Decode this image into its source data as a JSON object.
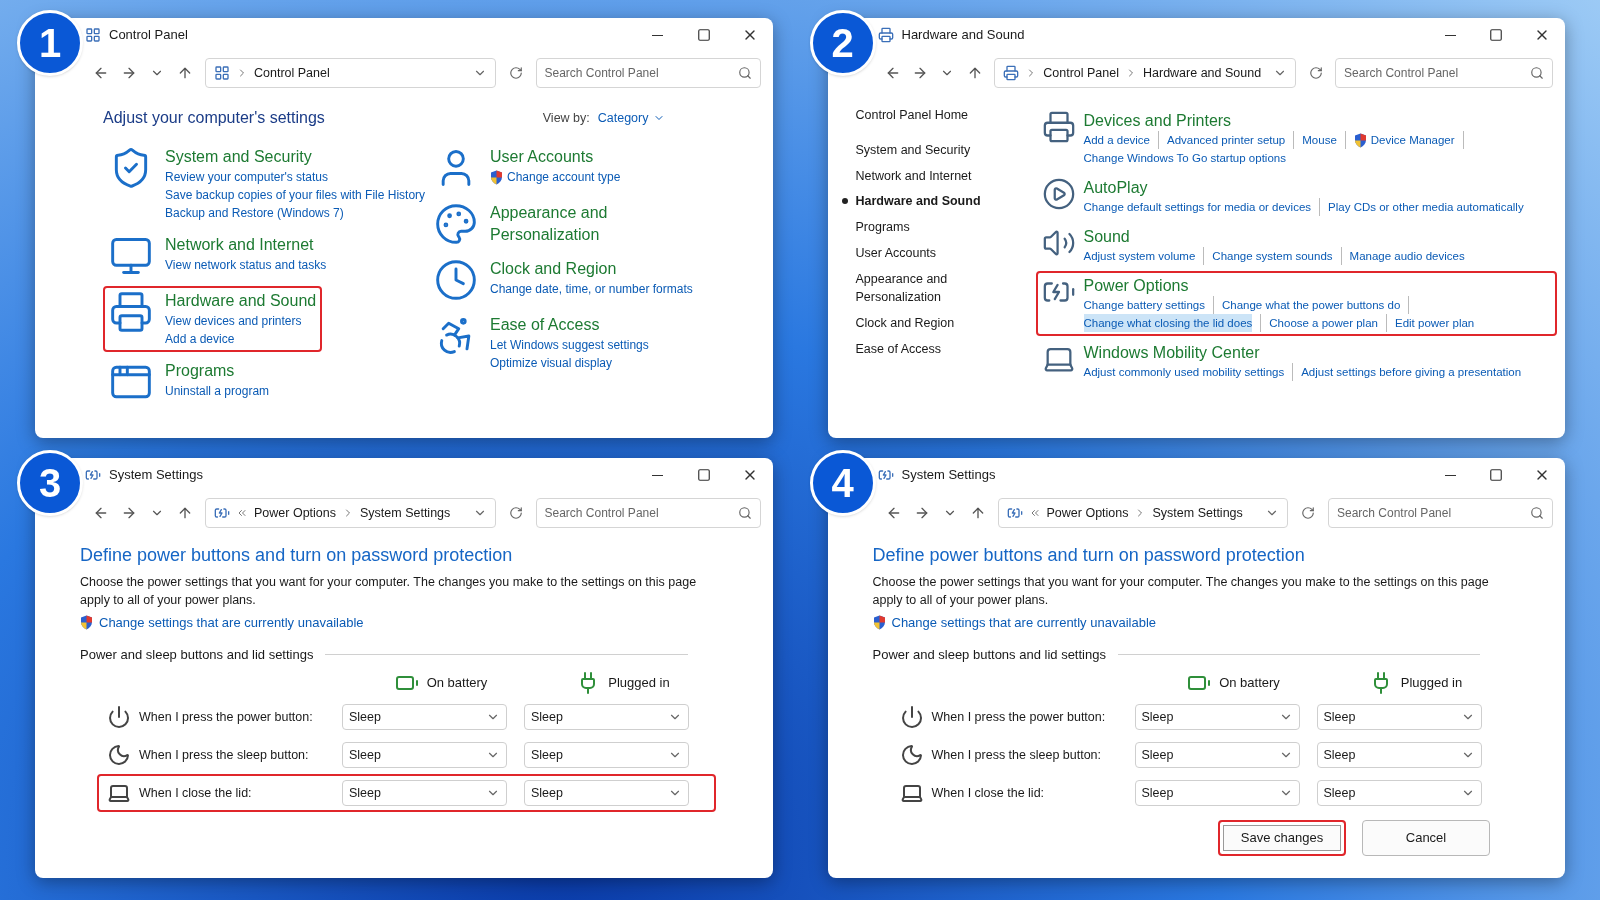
{
  "panels": [
    {
      "kind": "category",
      "step": "1",
      "title": "Control Panel",
      "truncated": false,
      "breadcrumb": [
        "Control Panel"
      ],
      "search_placeholder": "Search Control Panel",
      "heading": "Adjust your computer's settings",
      "view_by_label": "View by:",
      "view_by_value": "Category",
      "category_columns": [
        [
          {
            "title": "System and Security",
            "highlighted": false,
            "links": [
              {
                "text": "Review your computer's status",
                "shield": false
              },
              {
                "text": "Save backup copies of your files with File History",
                "shield": false
              },
              {
                "text": "Backup and Restore (Windows 7)",
                "shield": false
              }
            ]
          },
          {
            "title": "Network and Internet",
            "highlighted": false,
            "links": [
              {
                "text": "View network status and tasks",
                "shield": false
              }
            ]
          },
          {
            "title": "Hardware and Sound",
            "highlighted": true,
            "links": [
              {
                "text": "View devices and printers",
                "shield": false
              },
              {
                "text": "Add a device",
                "shield": false
              }
            ]
          },
          {
            "title": "Programs",
            "highlighted": false,
            "links": [
              {
                "text": "Uninstall a program",
                "shield": false
              }
            ]
          }
        ],
        [
          {
            "title": "User Accounts",
            "highlighted": false,
            "links": [
              {
                "text": "Change account type",
                "shield": true
              }
            ]
          },
          {
            "title": "Appearance and Personalization",
            "highlighted": false
          },
          {
            "title": "Clock and Region",
            "highlighted": false,
            "links": [
              {
                "text": "Change date, time, or number formats",
                "shield": false
              }
            ]
          },
          {
            "title": "Ease of Access",
            "highlighted": false,
            "links": [
              {
                "text": "Let Windows suggest settings",
                "shield": false
              },
              {
                "text": "Optimize visual display",
                "shield": false
              }
            ]
          }
        ]
      ]
    },
    {
      "kind": "hardware",
      "step": "2",
      "title": "Hardware and Sound",
      "truncated": false,
      "breadcrumb": [
        "Control Panel",
        "Hardware and Sound"
      ],
      "search_placeholder": "Search Control Panel",
      "sidebar_home": "Control Panel Home",
      "sidebar": [
        {
          "label": "System and Security",
          "selected": false
        },
        {
          "label": "Network and Internet",
          "selected": false
        },
        {
          "label": "Hardware and Sound",
          "selected": true
        },
        {
          "label": "Programs",
          "selected": false
        },
        {
          "label": "User Accounts",
          "selected": false
        },
        {
          "label": "Appearance and Personalization",
          "selected": false
        },
        {
          "label": "Clock and Region",
          "selected": false
        },
        {
          "label": "Ease of Access",
          "selected": false
        }
      ],
      "sections": [
        {
          "title": "Devices and Printers",
          "highlighted": false,
          "links": [
            {
              "text": "Add a device",
              "shield": false,
              "selected": false
            },
            {
              "text": "Advanced printer setup",
              "shield": false,
              "selected": false
            },
            {
              "text": "Mouse",
              "shield": false,
              "selected": false
            },
            {
              "text": "Device Manager",
              "shield": true,
              "selected": false
            },
            {
              "text": "Change Windows To Go startup options",
              "shield": false,
              "selected": false
            }
          ]
        },
        {
          "title": "AutoPlay",
          "highlighted": false,
          "links": [
            {
              "text": "Change default settings for media or devices",
              "shield": false,
              "selected": false
            },
            {
              "text": "Play CDs or other media automatically",
              "shield": false,
              "selected": false
            }
          ]
        },
        {
          "title": "Sound",
          "highlighted": false,
          "links": [
            {
              "text": "Adjust system volume",
              "shield": false,
              "selected": false
            },
            {
              "text": "Change system sounds",
              "shield": false,
              "selected": false
            },
            {
              "text": "Manage audio devices",
              "shield": false,
              "selected": false
            }
          ]
        },
        {
          "title": "Power Options",
          "highlighted": true,
          "links": [
            {
              "text": "Change battery settings",
              "shield": false,
              "selected": false
            },
            {
              "text": "Change what the power buttons do",
              "shield": false,
              "selected": false
            },
            {
              "text": "Change what closing the lid does",
              "shield": false,
              "selected": true
            },
            {
              "text": "Choose a power plan",
              "shield": false,
              "selected": false
            },
            {
              "text": "Edit power plan",
              "shield": false,
              "selected": false
            }
          ]
        },
        {
          "title": "Windows Mobility Center",
          "highlighted": false,
          "links": [
            {
              "text": "Adjust commonly used mobility settings",
              "shield": false,
              "selected": false
            },
            {
              "text": "Adjust settings before giving a presentation",
              "shield": false,
              "selected": false
            }
          ]
        }
      ]
    },
    {
      "kind": "settings",
      "step": "3",
      "title": "System Settings",
      "truncated": true,
      "breadcrumb": [
        "Power Options",
        "System Settings"
      ],
      "search_placeholder": "Search Control Panel",
      "heading": "Define power buttons and turn on password protection",
      "description": "Choose the power settings that you want for your computer. The changes you make to the settings on this page apply to all of your power plans.",
      "admin_link": "Change settings that are currently unavailable",
      "group_label": "Power and sleep buttons and lid settings",
      "columns": [
        "On battery",
        "Plugged in"
      ],
      "rows": [
        {
          "label": "When I press the power button:",
          "values": [
            "Sleep",
            "Sleep"
          ],
          "highlighted": false
        },
        {
          "label": "When I press the sleep button:",
          "values": [
            "Sleep",
            "Sleep"
          ],
          "highlighted": false
        },
        {
          "label": "When I close the lid:",
          "values": [
            "Sleep",
            "Sleep"
          ],
          "highlighted": true
        }
      ]
    },
    {
      "kind": "settings",
      "step": "4",
      "title": "System Settings",
      "truncated": true,
      "breadcrumb": [
        "Power Options",
        "System Settings"
      ],
      "search_placeholder": "Search Control Panel",
      "heading": "Define power buttons and turn on password protection",
      "description": "Choose the power settings that you want for your computer. The changes you make to the settings on this page apply to all of your power plans.",
      "admin_link": "Change settings that are currently unavailable",
      "group_label": "Power and sleep buttons and lid settings",
      "columns": [
        "On battery",
        "Plugged in"
      ],
      "rows": [
        {
          "label": "When I press the power button:",
          "values": [
            "Sleep",
            "Sleep"
          ],
          "highlighted": false
        },
        {
          "label": "When I press the sleep button:",
          "values": [
            "Sleep",
            "Sleep"
          ],
          "highlighted": false
        },
        {
          "label": "When I close the lid:",
          "values": [
            "Sleep",
            "Sleep"
          ],
          "highlighted": false
        }
      ],
      "buttons": [
        {
          "label": "Save changes",
          "highlighted": true
        },
        {
          "label": "Cancel",
          "highlighted": false
        }
      ]
    }
  ]
}
